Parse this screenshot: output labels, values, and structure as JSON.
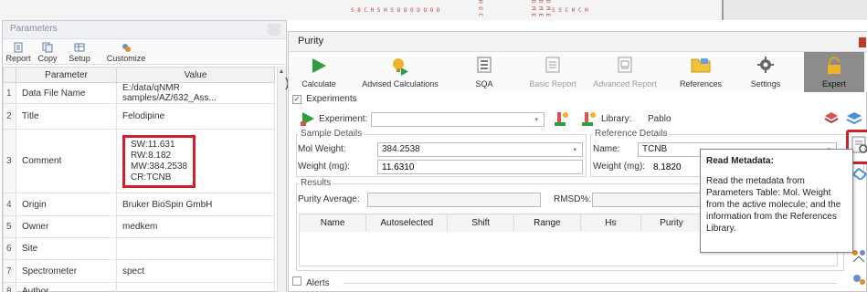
{
  "spectrum_labels": [
    "S 8 C H S H S O O O O O O O",
    "H O C",
    "D M E",
    "D M E",
    "D M E",
    "S S C H C H"
  ],
  "parameters": {
    "title": "Parameters",
    "toolbar": [
      {
        "label": "Report",
        "icon": "report-icon"
      },
      {
        "label": "Copy",
        "icon": "copy-icon"
      },
      {
        "label": "Setup",
        "icon": "setup-icon"
      },
      {
        "label": "Customize",
        "icon": "customize-icon"
      }
    ],
    "columns": [
      "Parameter",
      "Value"
    ],
    "rows": [
      {
        "num": "1",
        "name": "Data File Name",
        "value": "E:/data/qNMR samples/AZ/632_Ass..."
      },
      {
        "num": "2",
        "name": "Title",
        "value": "Felodipine"
      },
      {
        "num": "3",
        "name": "Comment",
        "lines": [
          "SW:11.631",
          "RW:8.182",
          "MW:384.2538",
          "CR:TCNB"
        ]
      },
      {
        "num": "4",
        "name": "Origin",
        "value": "Bruker BioSpin GmbH"
      },
      {
        "num": "5",
        "name": "Owner",
        "value": "medkem"
      },
      {
        "num": "6",
        "name": "Site",
        "value": ""
      },
      {
        "num": "7",
        "name": "Spectrometer",
        "value": "spect"
      },
      {
        "num": "8",
        "name": "Author",
        "value": ""
      }
    ]
  },
  "purity": {
    "title": "Purity",
    "toolbar": [
      {
        "label": "Calculate",
        "icon": "play-icon",
        "enabled": true
      },
      {
        "label": "Advised Calculations",
        "icon": "lightbulb-play-icon",
        "enabled": true
      },
      {
        "label": "SQA",
        "icon": "sqa-icon",
        "enabled": true
      },
      {
        "label": "Basic Report",
        "icon": "report-page-icon",
        "enabled": false
      },
      {
        "label": "Advanced Report",
        "icon": "report-page-icon",
        "enabled": false
      },
      {
        "label": "References",
        "icon": "folder-icon",
        "enabled": true
      },
      {
        "label": "Settings",
        "icon": "gear-icon",
        "enabled": true
      },
      {
        "label": "Expert",
        "icon": "lock-icon",
        "enabled": true
      }
    ],
    "experiments_label": "Experiments",
    "experiments_checked": true,
    "experiment_label": "Experiment:",
    "experiment_value": "",
    "library_label": "Library:",
    "library_value": "Pablo",
    "sample": {
      "group": "Sample Details",
      "mol_weight_label": "Mol Weight:",
      "mol_weight_value": "384.2538",
      "weight_label": "Weight (mg):",
      "weight_value": "11.6310"
    },
    "reference": {
      "group": "Reference Details",
      "name_label": "Name:",
      "name_value": "TCNB",
      "weight_label": "Weight (mg):",
      "weight_value": "8.1820"
    },
    "results": {
      "group": "Results",
      "purity_avg_label": "Purity Average:",
      "rmsd_label": "RMSD%:",
      "columns": [
        "Name",
        "Autoselected",
        "Shift",
        "Range",
        "Hs",
        "Purity"
      ]
    },
    "alerts_label": "Alerts",
    "tooltip": {
      "title": "Read Metadata:",
      "body": "Read the metadata from Parameters Table: Mol. Weight from the active molecule; and the information from the References Library."
    }
  }
}
